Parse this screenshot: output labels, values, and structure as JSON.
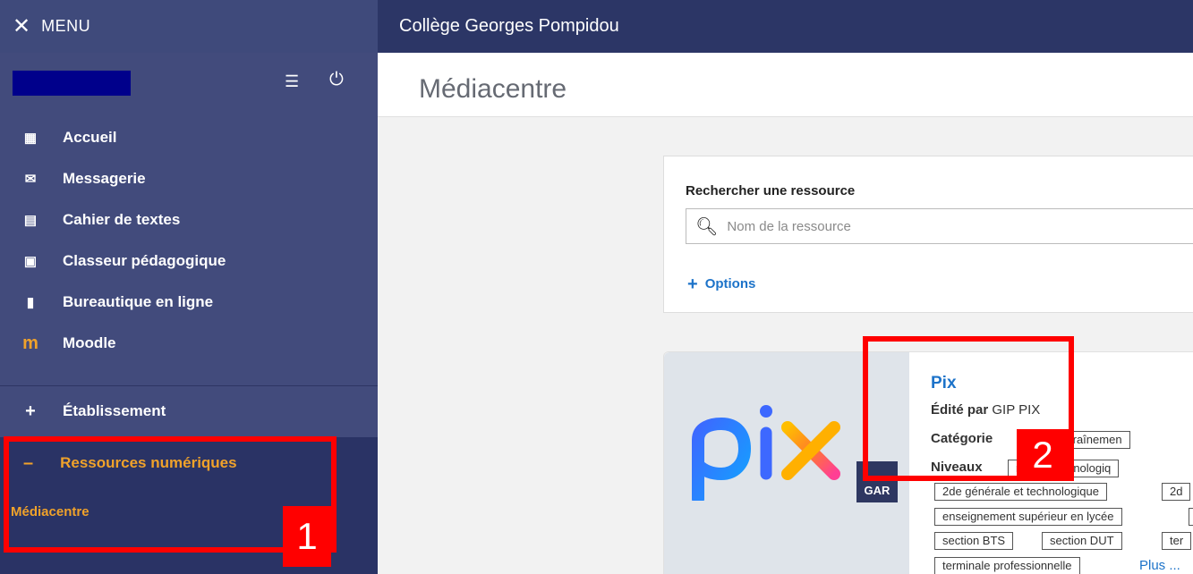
{
  "topbar": {
    "menu_label": "MENU",
    "school_name": "Collège Georges Pompidou"
  },
  "sidebar": {
    "items": [
      {
        "label": "Accueil",
        "icon": "grid-icon"
      },
      {
        "label": "Messagerie",
        "icon": "envelope-icon"
      },
      {
        "label": "Cahier de textes",
        "icon": "calendar-icon"
      },
      {
        "label": "Classeur pédagogique",
        "icon": "folder-icon"
      },
      {
        "label": "Bureautique en ligne",
        "icon": "office-icon"
      },
      {
        "label": "Moodle",
        "icon": "moodle-icon"
      }
    ],
    "etablissement": "Établissement",
    "ressources": "Ressources numériques",
    "mediacentre_link": "Médiacentre"
  },
  "main": {
    "page_title": "Médiacentre",
    "search": {
      "title": "Rechercher une ressource",
      "placeholder": "Nom de la ressource",
      "options": "Options"
    },
    "resource": {
      "name": "Pix",
      "edited_by_label": "Édité par",
      "editor": "GIP PIX",
      "categorie_label": "Catégorie",
      "categorie_tag": "ces d'entraînemen",
      "niveaux_label": "Niveaux",
      "niveaux_tag": "rale et technologiq",
      "tags_row1": [
        "2de générale et technologique",
        "2d"
      ],
      "tags_row2": [
        "enseignement supérieur en lycée",
        ""
      ],
      "tags_row3": [
        "section BTS",
        "section DUT",
        "ter"
      ],
      "tags_row4": [
        "terminale professionnelle"
      ],
      "plus": "Plus ...",
      "logo_text": "pix",
      "gar_badge": "GAR"
    }
  },
  "annotations": {
    "box1": "1",
    "box2": "2"
  },
  "colors": {
    "sidebar": "#424b7c",
    "header": "#2c3666",
    "accent": "#f0a22a",
    "link": "#1d73c9",
    "annotation": "#ff0000"
  }
}
